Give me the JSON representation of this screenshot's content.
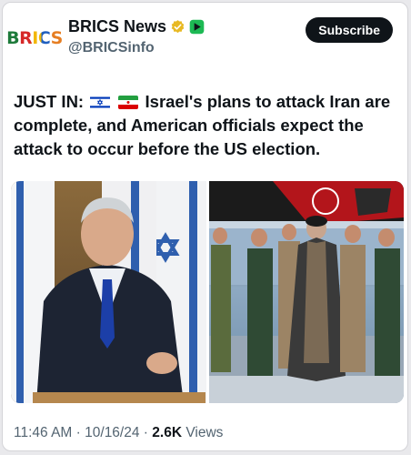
{
  "account": {
    "avatar_text": "BRICS",
    "display_name": "BRICS News",
    "handle": "@BRICSinfo",
    "verified_icon": "gold-verified-badge-icon",
    "affiliate_icon": "green-affiliate-badge-icon"
  },
  "actions": {
    "subscribe_label": "Subscribe"
  },
  "tweet": {
    "prefix": "JUST IN:",
    "flags": [
      "israel-flag-icon",
      "iran-flag-icon"
    ],
    "body": "Israel's plans to attack Iran are complete, and American officials expect the attack to occur before the US election."
  },
  "media": {
    "images": [
      "politician-at-podium-photo",
      "military-officials-procession-photo"
    ]
  },
  "meta": {
    "time": "11:46 AM",
    "date": "10/16/24",
    "views_count": "2.6K",
    "views_label": "Views",
    "separator": "·"
  },
  "colors": {
    "text": "#0f1419",
    "secondary_text": "#536471",
    "button_bg": "#0f1419",
    "verified_gold": "#e8b923"
  }
}
